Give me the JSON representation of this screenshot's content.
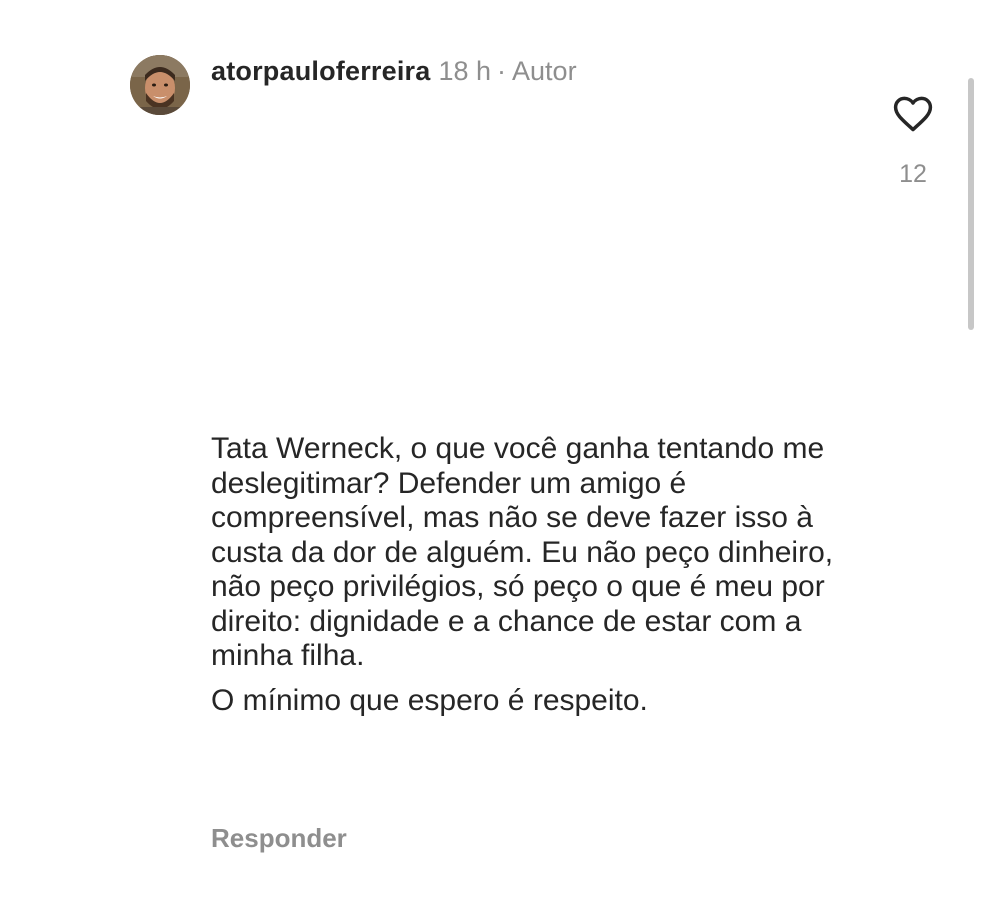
{
  "comment": {
    "username": "atorpauloferreira",
    "time": "18 h",
    "separator": "·",
    "role": "Autor",
    "paragraphs": [
      "Tata Werneck, o que você ganha tentando me deslegitimar? Defender um amigo é compreensível, mas não se deve fazer isso à custa da dor de alguém. Eu não peço dinheiro, não peço privilégios, só peço o que é meu por direito: dignidade e a chance de estar com a minha filha.",
      "O mínimo que espero é respeito."
    ],
    "reply_label": "Responder"
  },
  "likes": {
    "icon": "heart-outline-icon",
    "count": "12"
  },
  "colors": {
    "text_primary": "#262626",
    "text_secondary": "#8e8e8e",
    "scrollbar": "#c7c7c7",
    "background": "#ffffff"
  }
}
